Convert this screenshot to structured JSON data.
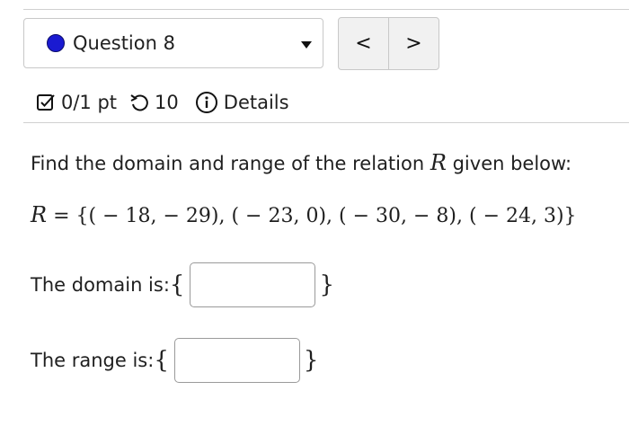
{
  "header": {
    "question_label": "Question 8",
    "status_color": "#1a1ad1",
    "prev_label": "<",
    "next_label": ">"
  },
  "meta": {
    "score": "0/1 pt",
    "attempts": "10",
    "details_label": "Details",
    "icons": [
      "checkbox-edit-icon",
      "retry-icon",
      "info-icon"
    ]
  },
  "problem": {
    "prompt_before": "Find the domain and range of the relation ",
    "prompt_var": "R",
    "prompt_after": " given below:",
    "relation_var": "R",
    "relation_body": " = {( − 18,  − 29), ( − 23, 0), ( − 30,  − 8), ( − 24, 3)}"
  },
  "answers": {
    "domain_label": "The domain is: ",
    "domain_value": "",
    "range_label": "The range is: ",
    "range_value": "",
    "open_brace": "{",
    "close_brace": "}"
  }
}
